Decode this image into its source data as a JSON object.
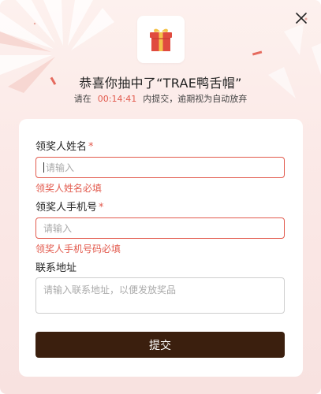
{
  "modal": {
    "title": "恭喜你抽中了“TRAE鸭舌帽”",
    "subtitle_prefix": "请在",
    "countdown": "00:14:41",
    "subtitle_suffix": "内提交，逾期视为自动放弃",
    "close_icon": "close-icon",
    "gift_icon": "gift-icon"
  },
  "form": {
    "name_label": "领奖人姓名",
    "name_required_mark": "*",
    "name_placeholder": "请输入",
    "name_error": "领奖人姓名必填",
    "phone_label": "领奖人手机号",
    "phone_required_mark": "*",
    "phone_placeholder": "请输入",
    "phone_error": "领奖人手机号码必填",
    "address_label": "联系地址",
    "address_placeholder": "请输入联系地址，以便发放奖品",
    "submit_label": "提交"
  },
  "colors": {
    "accent_error": "#e25a4d",
    "submit_bg": "#3b1f0e",
    "gift_red": "#e04b3f",
    "gift_ribbon": "#f4c34a"
  }
}
